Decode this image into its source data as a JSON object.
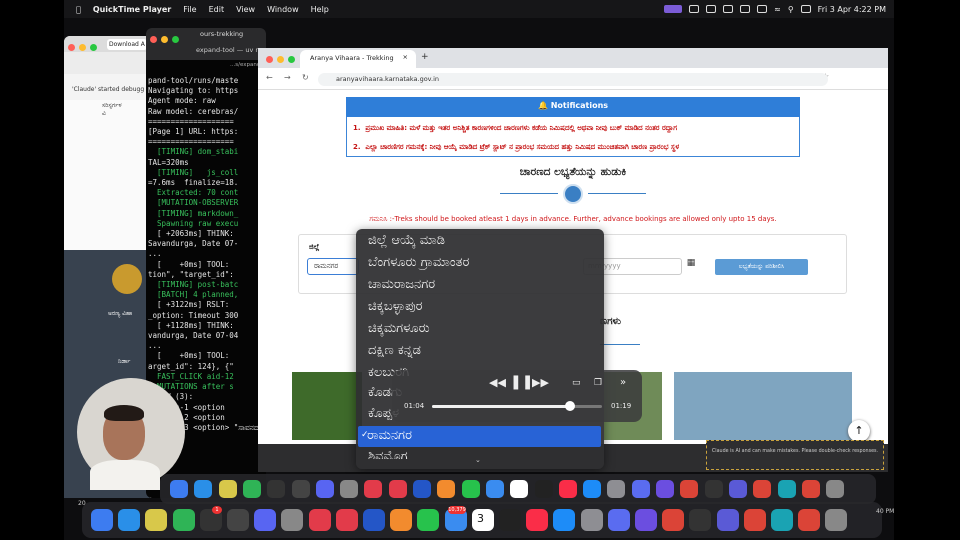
{
  "menubar": {
    "app": "QuickTime Player",
    "items": [
      "File",
      "Edit",
      "View",
      "Window",
      "Help"
    ],
    "datetime": "Fri 3 Apr  4:22 PM"
  },
  "back_window": {
    "tab_label": "Download A",
    "notice": "'Claude' started debugg",
    "snippet": "ಸರಿಸ್ಪರ್ಗಳ ವಿ",
    "caption1": "ಅರಣ್ಯ ವಿಹಾ",
    "caption2": "ನಿರ್ಡಾ"
  },
  "terminal": {
    "title": "ours-trekking",
    "subtitle": "expand-tool — uv run",
    "path": "...s/expand-t",
    "lines": [
      "pand-tool/runs/maste",
      "Navigating to: https",
      "Agent mode: raw",
      "Raw model: cerebras/",
      "",
      "===================",
      "[Page 1] URL: https:",
      "===================",
      "  [TIMING] dom_stabi",
      "TAL=320ms",
      "  [TIMING]   js_coll",
      "=7.6ms  finalize=18.",
      "  Extracted: 70 cont",
      "  [MUTATION-OBSERVER",
      "  [TIMING] markdown_",
      "  Spawning raw execu",
      "  [ +2063ms] THINK:",
      "Savandurga, Date 07-",
      "...",
      "  [    +0ms] TOOL:",
      "tion\", \"target_id\":",
      "  [TIMING] post-batc",
      "  [BATCH] 4 planned,",
      "  [ +3122ms] RSLT:",
      "_option: Timeout 300",
      "  [ +1128ms] THINK:",
      "vandurga, Date 07-04",
      "...",
      "  [    +0ms] TOOL:",
      "arget_id\": 124}, {\"",
      "  FAST_CLICK aid-12",
      "  MUTATIONS after s",
      "  NEW (3):",
      "    obs-1 <option",
      "    obs-2 <option",
      "    obs-3 <option> \"ಸಾವನದುರ್ಗ ಬೇಡ"
    ]
  },
  "browser": {
    "tab_title": "Aranya Vihaara - Trekking",
    "url": "aranyavihaara.karnataka.gov.in"
  },
  "page": {
    "notifications_title": "🔔 Notifications",
    "notifications": [
      "ಪ್ರಮುಖ ಮಾಹಿತಿ: ಮಳೆ ಮತ್ತು ಇತರ ಅನಿಶ್ಚಿತ ಕಾರಣಗಳಿಂದ ಚಾರಣಗಳು ಕಡೆಯ ನಿಮಿಷದಲ್ಲಿ ಅಥವಾ ನೀವು ಬುಕ್ ಮಾಡಿದ ನಂತರ ರದ್ದಾಗ",
      "ಎಲ್ಲಾ ಚಾರಣಿಗರ ಗಮನಕ್ಕೆ: ನೀವು ಆಯ್ಕೆ ಮಾಡಿದ ಟ್ರೆಕ್ ಸ್ಲಾಟ್ ನ ಪ್ರಾರಂಭ ಸಮಯದ ಹತ್ತು ನಿಮಿಷದ ಮುಂಚಿತವಾಗಿ ಚಾರಣ ಪ್ರಾರಂಭ ಸ್ಥಳ"
    ],
    "heading": "ಚಾರಣದ ಲಭ್ಯತೆಯನ್ನು ಹುಡುಕಿ",
    "note": "ಗಮನಿಸಿ :-Treks should be booked atleast 1 days in advance. Further, advance bookings are allowed only upto 15 days.",
    "district_label": "ಜಿಲ್ಲೆ",
    "district_value": "ರಾಮನಗರ",
    "date_placeholder": "mm-yyyy",
    "check_button": "ಲಭ್ಯತೆಯನ್ನು ಪರಿಶೀಲಿಸಿ",
    "section_heading_right": "ಣಗಳು",
    "claude_notice": "Claude is AI and can make mistakes. Please double-check responses."
  },
  "dropdown": {
    "options": [
      "ಜಿಲ್ಲೆ ಆಯ್ಕೆ ಮಾಡಿ",
      "ಬೆಂಗಳೂರು ಗ್ರಾಮಾಂತರ",
      "ಚಾಮರಾಜನಗರ",
      "ಚಿಕ್ಕಬಳ್ಳಾಪುರ",
      "ಚಿಕ್ಕಮಗಳೂರು",
      "ದಕ್ಷಿಣ ಕನ್ನಡ",
      "ಕಲಬುರಗಿ",
      "ಕೊಡಗು",
      "ಕೊಪ್ಪಳ"
    ],
    "selected": "ರಾಮನಗರ",
    "next_partial": "ಶಿವಮೊಗ್ಗ"
  },
  "player": {
    "current_time": "01:04",
    "duration": "01:19",
    "progress": 0.81
  },
  "dock": {
    "badge_mail": "10,379",
    "badge_terminal": "1",
    "calendar_day": "3",
    "clock_left": "20",
    "clock_right": "40 PM"
  }
}
